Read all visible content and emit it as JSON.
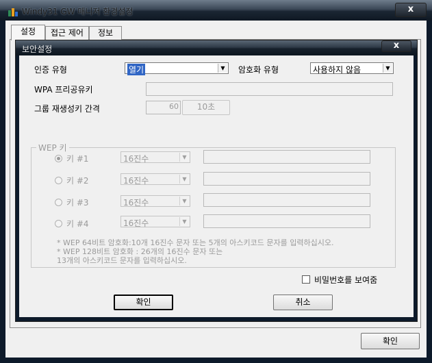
{
  "window": {
    "title": "Windy31 GW 매니저 환경설정",
    "close_label": "x",
    "ok_label": "확인"
  },
  "tabs": [
    {
      "label": "설정"
    },
    {
      "label": "접근 제어"
    },
    {
      "label": "정보"
    }
  ],
  "dialog": {
    "title": "보안설정",
    "close_label": "x",
    "auth_type": {
      "label": "인증 유형",
      "value": "열기"
    },
    "encryption_type": {
      "label": "암호화 유형",
      "value": "사용하지 않음"
    },
    "wpa_key": {
      "label": "WPA 프리공유키",
      "value": ""
    },
    "group_rekey": {
      "label": "그룹 재생성키 간격",
      "value": "60",
      "unit_button": "10초"
    },
    "wep": {
      "legend": "WEP 키",
      "keys": [
        {
          "label": "키 #1",
          "format": "16진수",
          "value": "",
          "checked": true
        },
        {
          "label": "키 #2",
          "format": "16진수",
          "value": "",
          "checked": false
        },
        {
          "label": "키 #3",
          "format": "16진수",
          "value": "",
          "checked": false
        },
        {
          "label": "키 #4",
          "format": "16진수",
          "value": "",
          "checked": false
        }
      ],
      "note_line1": "* WEP 64비트 암호화:10개 16진수 문자 또는 5개의 아스키코드 문자를 입력하십시오.",
      "note_line2": "* WEP 128비트 암호화 : 26개의 16진수 문자 또는",
      "note_line3": "13개의 아스키코드 문자를 입력하십시오."
    },
    "show_password_label": "비밀번호를 보여줌",
    "ok_label": "확인",
    "cancel_label": "취소"
  },
  "colors": {
    "selection": "#3166c5",
    "titlebar": "#1b2633",
    "disabled_text": "#9a9a9a"
  }
}
